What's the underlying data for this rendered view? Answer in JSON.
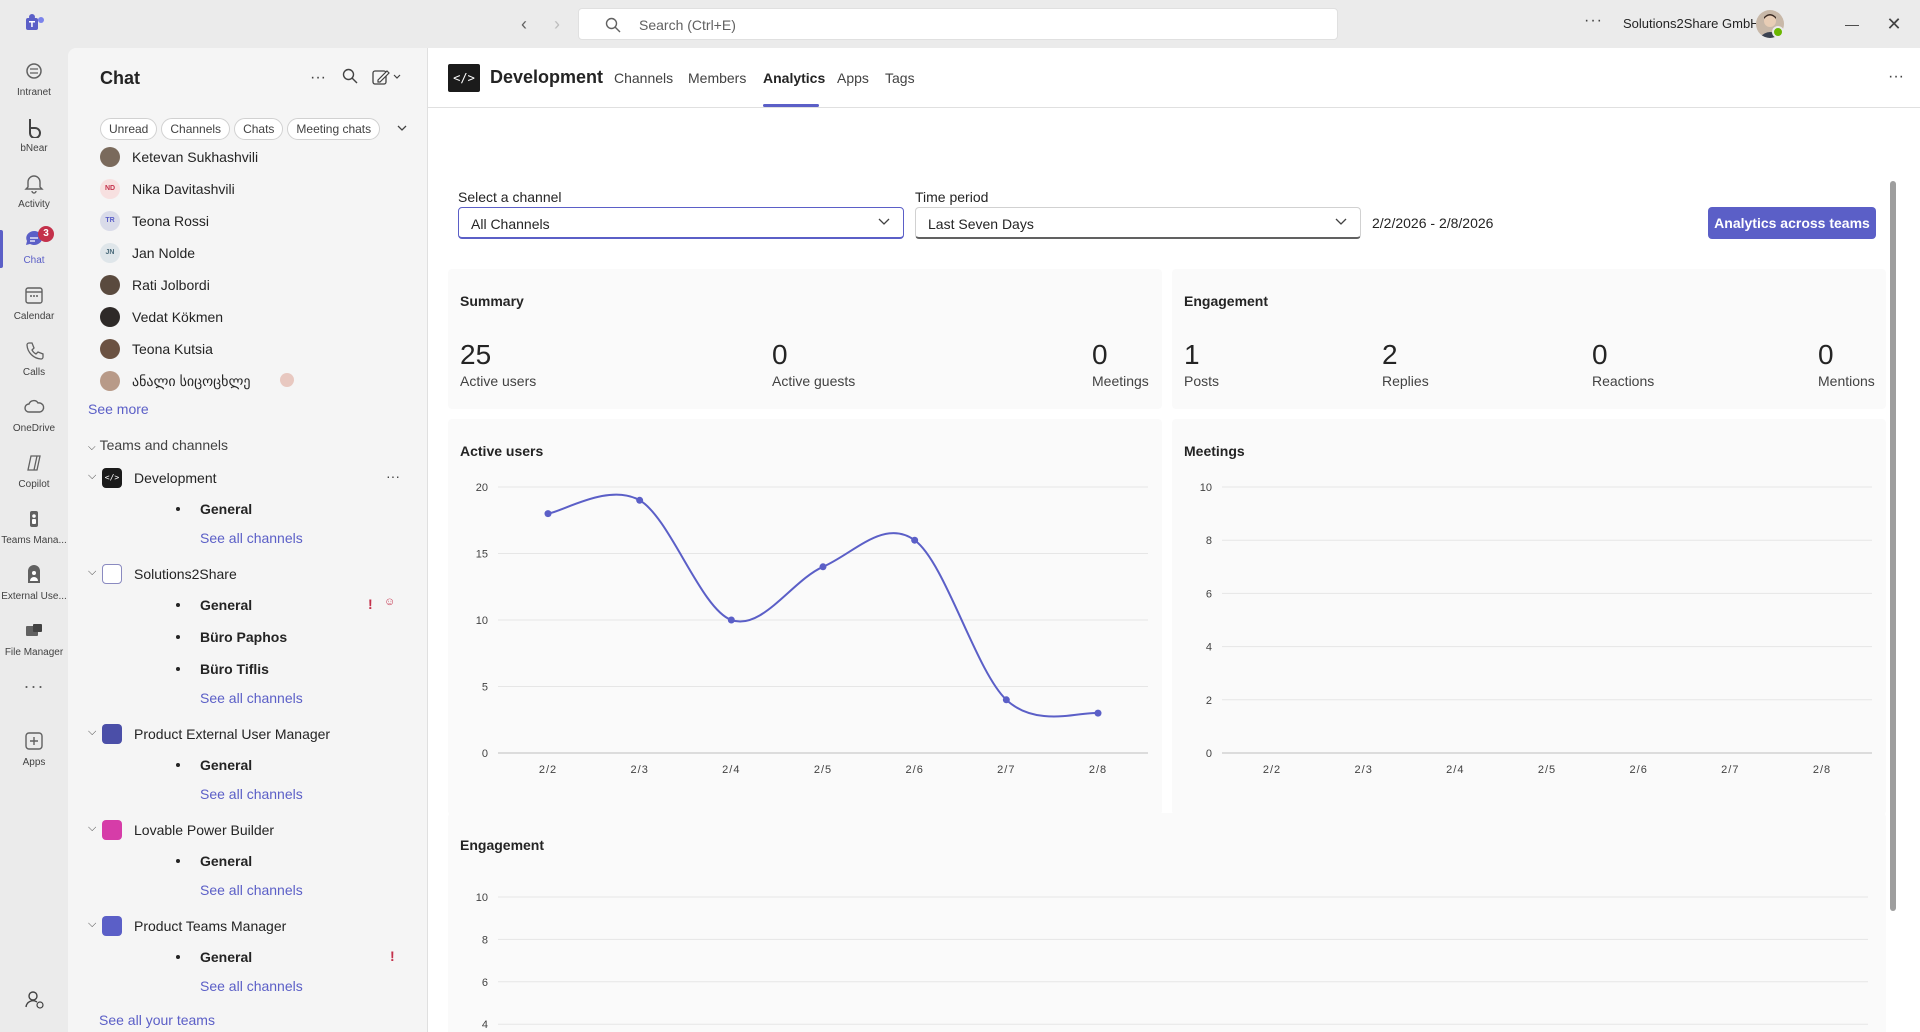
{
  "titlebar": {
    "search_placeholder": "Search (Ctrl+E)",
    "org_name": "Solutions2Share GmbH"
  },
  "rail": {
    "items": [
      {
        "label": "Intranet",
        "icon": "intranet-icon"
      },
      {
        "label": "bNear",
        "icon": "bnear-icon"
      },
      {
        "label": "Activity",
        "icon": "bell-icon"
      },
      {
        "label": "Chat",
        "icon": "chat-icon",
        "badge": "3"
      },
      {
        "label": "Calendar",
        "icon": "calendar-icon"
      },
      {
        "label": "Calls",
        "icon": "phone-icon"
      },
      {
        "label": "OneDrive",
        "icon": "cloud-icon"
      },
      {
        "label": "Copilot",
        "icon": "copilot-icon"
      },
      {
        "label": "Teams Mana...",
        "icon": "teams-manager-icon"
      },
      {
        "label": "External Use...",
        "icon": "external-user-icon"
      },
      {
        "label": "File Manager",
        "icon": "file-manager-icon"
      },
      {
        "label": "Apps",
        "icon": "apps-add-icon"
      }
    ]
  },
  "chatpanel": {
    "title": "Chat",
    "filters": [
      "Unread",
      "Channels",
      "Chats",
      "Meeting chats"
    ],
    "people": [
      {
        "name": "Ketevan Sukhashvili",
        "initials": ""
      },
      {
        "name": "Nika Davitashvili",
        "initials": "ND"
      },
      {
        "name": "Teona Rossi",
        "initials": "TR"
      },
      {
        "name": "Jan Nolde",
        "initials": "JN"
      },
      {
        "name": "Rati Jolbordi",
        "initials": ""
      },
      {
        "name": "Vedat Kökmen",
        "initials": ""
      },
      {
        "name": "Teona Kutsia",
        "initials": ""
      },
      {
        "name": "ანალი სიცოცხლე",
        "initials": ""
      }
    ],
    "see_more": "See more",
    "teams_header": "Teams and channels",
    "teams": [
      {
        "name": "Development",
        "channels": [
          "General"
        ],
        "see_all": "See all channels"
      },
      {
        "name": "Solutions2Share",
        "channels": [
          "General",
          "Büro Paphos",
          "Büro Tiflis"
        ],
        "see_all": "See all channels"
      },
      {
        "name": "Product External User Manager",
        "channels": [
          "General"
        ],
        "see_all": "See all channels"
      },
      {
        "name": "Lovable Power Builder",
        "channels": [
          "General"
        ],
        "see_all": "See all channels"
      },
      {
        "name": "Product Teams Manager",
        "channels": [
          "General"
        ],
        "see_all": "See all channels"
      }
    ],
    "see_all_teams": "See all your teams"
  },
  "main": {
    "team_title": "Development",
    "logo_text": "</>",
    "tabs": [
      "Channels",
      "Members",
      "Analytics",
      "Apps",
      "Tags"
    ],
    "active_tab": "Analytics",
    "channel_label": "Select a channel",
    "channel_value": "All Channels",
    "period_label": "Time period",
    "period_value": "Last Seven Days",
    "date_range": "2/2/2026 - 2/8/2026",
    "analytics_button": "Analytics across teams",
    "summary": {
      "title": "Summary",
      "stats": [
        {
          "value": "25",
          "label": "Active users"
        },
        {
          "value": "0",
          "label": "Active guests"
        },
        {
          "value": "0",
          "label": "Meetings"
        }
      ]
    },
    "engagement_summary": {
      "title": "Engagement",
      "stats": [
        {
          "value": "1",
          "label": "Posts"
        },
        {
          "value": "2",
          "label": "Replies"
        },
        {
          "value": "0",
          "label": "Reactions"
        },
        {
          "value": "0",
          "label": "Mentions"
        }
      ]
    },
    "active_users_title": "Active users",
    "meetings_title": "Meetings",
    "engagement_title": "Engagement"
  },
  "chart_data": [
    {
      "type": "line",
      "title": "Active users",
      "categories": [
        "2/2",
        "2/3",
        "2/4",
        "2/5",
        "2/6",
        "2/7",
        "2/8"
      ],
      "values": [
        18,
        19,
        10,
        14,
        16,
        4,
        3
      ],
      "ylim": [
        0,
        20
      ],
      "yticks": [
        0,
        5,
        10,
        15,
        20
      ],
      "color": "#5b5fc7",
      "grid": true
    },
    {
      "type": "line",
      "title": "Meetings",
      "categories": [
        "2/2",
        "2/3",
        "2/4",
        "2/5",
        "2/6",
        "2/7",
        "2/8"
      ],
      "values": [],
      "ylim": [
        0,
        10
      ],
      "yticks": [
        0,
        2,
        4,
        6,
        8,
        10
      ],
      "grid": true
    },
    {
      "type": "line",
      "title": "Engagement",
      "categories": [],
      "values": [],
      "ylim": [
        0,
        10
      ],
      "yticks": [
        4,
        6,
        8,
        10
      ],
      "grid": true
    }
  ],
  "colors": {
    "accent": "#5b5fc7",
    "badge": "#c4314b",
    "urgent": "#c4314b"
  }
}
